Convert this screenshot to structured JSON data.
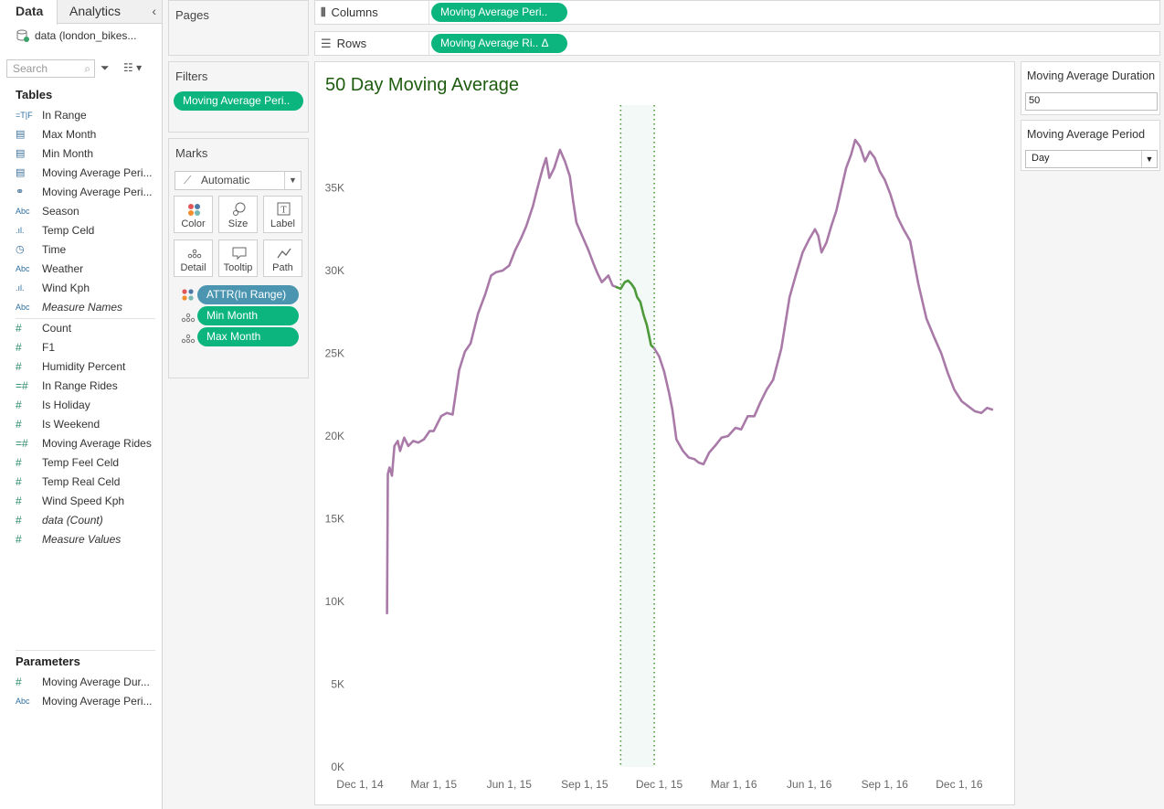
{
  "data_pane": {
    "tabs": [
      "Data",
      "Analytics"
    ],
    "datasource": "data (london_bikes...",
    "search_placeholder": "Search",
    "tables_title": "Tables",
    "dimensions": [
      {
        "type": "=T|F",
        "name": "In Range"
      },
      {
        "type": "cal",
        "name": "Max Month"
      },
      {
        "type": "cal",
        "name": "Min Month"
      },
      {
        "type": "cal",
        "name": "Moving Average Peri..."
      },
      {
        "type": "link",
        "name": "Moving Average Peri..."
      },
      {
        "type": "Abc",
        "name": "Season"
      },
      {
        "type": "bin",
        "name": "Temp Celd"
      },
      {
        "type": "time",
        "name": "Time"
      },
      {
        "type": "Abc",
        "name": "Weather"
      },
      {
        "type": "bin",
        "name": "Wind Kph"
      },
      {
        "type": "Abc",
        "name": "Measure Names",
        "italic": true
      }
    ],
    "measures": [
      {
        "type": "#",
        "name": "Count"
      },
      {
        "type": "#",
        "name": "F1"
      },
      {
        "type": "#",
        "name": "Humidity Percent"
      },
      {
        "type": "=#",
        "name": "In Range Rides"
      },
      {
        "type": "#",
        "name": "Is Holiday"
      },
      {
        "type": "#",
        "name": "Is Weekend"
      },
      {
        "type": "=#",
        "name": "Moving Average Rides"
      },
      {
        "type": "#",
        "name": "Temp Feel Celd"
      },
      {
        "type": "#",
        "name": "Temp Real Celd"
      },
      {
        "type": "#",
        "name": "Wind Speed Kph"
      },
      {
        "type": "#",
        "name": "data (Count)",
        "italic": true
      },
      {
        "type": "#",
        "name": "Measure Values",
        "italic": true
      }
    ],
    "parameters_title": "Parameters",
    "parameters": [
      {
        "type": "#",
        "name": "Moving Average Dur..."
      },
      {
        "type": "Abc",
        "name": "Moving Average Peri..."
      }
    ]
  },
  "pages": {
    "title": "Pages"
  },
  "filters": {
    "title": "Filters",
    "pill": "Moving Average Peri.."
  },
  "marks": {
    "title": "Marks",
    "type": "Automatic",
    "buttons": [
      "Color",
      "Size",
      "Label",
      "Detail",
      "Tooltip",
      "Path"
    ],
    "pills": [
      {
        "label": "ATTR(In Range)",
        "color": "blue"
      },
      {
        "label": "Min Month",
        "color": "green"
      },
      {
        "label": "Max Month",
        "color": "green"
      }
    ]
  },
  "columns": {
    "label": "Columns",
    "pill": "Moving Average Peri.."
  },
  "rows": {
    "label": "Rows",
    "pill": "Moving Average Ri.. Δ"
  },
  "params_panel": {
    "duration": {
      "title": "Moving Average Duration",
      "value": "50"
    },
    "period": {
      "title": "Moving Average Period",
      "value": "Day"
    }
  },
  "colors": {
    "pill_green": "#0db57e",
    "pill_blue": "#4b95b0",
    "line_purple": "#a97aa8",
    "line_green": "#4e9a3a",
    "title_green": "#1f5c10"
  },
  "chart_data": {
    "type": "line",
    "title": "50 Day Moving Average",
    "xlabel": "",
    "ylabel": "",
    "ylim": [
      0,
      40000
    ],
    "yticks": [
      0,
      5000,
      10000,
      15000,
      20000,
      25000,
      30000,
      35000
    ],
    "ytick_labels": [
      "0K",
      "5K",
      "10K",
      "15K",
      "20K",
      "25K",
      "30K",
      "35K"
    ],
    "xticks": [
      "2014-12-01",
      "2015-03-01",
      "2015-06-01",
      "2015-09-01",
      "2015-12-01",
      "2016-03-01",
      "2016-06-01",
      "2016-09-01",
      "2016-12-01"
    ],
    "xtick_labels": [
      "Dec 1, 14",
      "Mar 1, 15",
      "Jun 1, 15",
      "Sep 1, 15",
      "Dec 1, 15",
      "Mar 1, 16",
      "Jun 1, 16",
      "Sep 1, 16",
      "Dec 1, 16"
    ],
    "xlim": [
      "2014-11-21",
      "2017-01-18"
    ],
    "highlight_range": [
      "2015-10-15",
      "2015-11-25"
    ],
    "series": [
      {
        "name": "",
        "color": "#a97aa8",
        "points": [
          [
            "2015-01-03",
            9300
          ],
          [
            "2015-01-04",
            17700
          ],
          [
            "2015-01-06",
            18100
          ],
          [
            "2015-01-09",
            17600
          ],
          [
            "2015-01-12",
            19400
          ],
          [
            "2015-01-16",
            19700
          ],
          [
            "2015-01-19",
            19100
          ],
          [
            "2015-01-24",
            19900
          ],
          [
            "2015-01-29",
            19400
          ],
          [
            "2015-02-04",
            19700
          ],
          [
            "2015-02-10",
            19600
          ],
          [
            "2015-02-17",
            19800
          ],
          [
            "2015-02-24",
            20300
          ],
          [
            "2015-03-01",
            20300
          ],
          [
            "2015-03-10",
            21200
          ],
          [
            "2015-03-17",
            21400
          ],
          [
            "2015-03-24",
            21300
          ],
          [
            "2015-04-01",
            24000
          ],
          [
            "2015-04-08",
            25100
          ],
          [
            "2015-04-15",
            25600
          ],
          [
            "2015-04-24",
            27400
          ],
          [
            "2015-05-03",
            28600
          ],
          [
            "2015-05-10",
            29700
          ],
          [
            "2015-05-16",
            29900
          ],
          [
            "2015-05-24",
            30000
          ],
          [
            "2015-06-01",
            30300
          ],
          [
            "2015-06-08",
            31200
          ],
          [
            "2015-06-16",
            32000
          ],
          [
            "2015-06-22",
            32700
          ],
          [
            "2015-06-30",
            33900
          ],
          [
            "2015-07-05",
            34900
          ],
          [
            "2015-07-12",
            36200
          ],
          [
            "2015-07-16",
            36800
          ],
          [
            "2015-07-20",
            35600
          ],
          [
            "2015-07-26",
            36200
          ],
          [
            "2015-08-02",
            37300
          ],
          [
            "2015-08-08",
            36600
          ],
          [
            "2015-08-14",
            35700
          ],
          [
            "2015-08-18",
            34200
          ],
          [
            "2015-08-22",
            32900
          ],
          [
            "2015-08-29",
            32100
          ],
          [
            "2015-09-06",
            31200
          ],
          [
            "2015-09-12",
            30400
          ],
          [
            "2015-09-17",
            29800
          ],
          [
            "2015-09-22",
            29300
          ],
          [
            "2015-09-30",
            29700
          ],
          [
            "2015-10-05",
            29100
          ],
          [
            "2015-10-10",
            29000
          ]
        ]
      },
      {
        "name": "",
        "color": "#4e9a3a",
        "points": [
          [
            "2015-10-10",
            29000
          ],
          [
            "2015-10-15",
            28900
          ],
          [
            "2015-10-20",
            29300
          ],
          [
            "2015-10-24",
            29400
          ],
          [
            "2015-10-28",
            29200
          ],
          [
            "2015-11-01",
            28900
          ],
          [
            "2015-11-04",
            28400
          ],
          [
            "2015-11-08",
            28100
          ],
          [
            "2015-11-12",
            27300
          ],
          [
            "2015-11-16",
            26700
          ],
          [
            "2015-11-21",
            25500
          ],
          [
            "2015-11-25",
            25300
          ]
        ]
      },
      {
        "name": "",
        "color": "#a97aa8",
        "points": [
          [
            "2015-11-25",
            25300
          ],
          [
            "2015-12-01",
            24800
          ],
          [
            "2015-12-07",
            23900
          ],
          [
            "2015-12-13",
            22600
          ],
          [
            "2015-12-17",
            21600
          ],
          [
            "2015-12-22",
            19800
          ],
          [
            "2015-12-30",
            19100
          ],
          [
            "2016-01-06",
            18700
          ],
          [
            "2016-01-13",
            18600
          ],
          [
            "2016-01-18",
            18400
          ],
          [
            "2016-01-24",
            18300
          ],
          [
            "2016-01-31",
            19000
          ],
          [
            "2016-02-07",
            19400
          ],
          [
            "2016-02-15",
            19900
          ],
          [
            "2016-02-23",
            20000
          ],
          [
            "2016-03-03",
            20500
          ],
          [
            "2016-03-10",
            20400
          ],
          [
            "2016-03-18",
            21200
          ],
          [
            "2016-03-26",
            21200
          ],
          [
            "2016-04-02",
            22000
          ],
          [
            "2016-04-10",
            22800
          ],
          [
            "2016-04-18",
            23400
          ],
          [
            "2016-04-28",
            25300
          ],
          [
            "2016-05-08",
            28400
          ],
          [
            "2016-05-16",
            29800
          ],
          [
            "2016-05-24",
            31100
          ],
          [
            "2016-06-01",
            31900
          ],
          [
            "2016-06-08",
            32500
          ],
          [
            "2016-06-12",
            32100
          ],
          [
            "2016-06-16",
            31100
          ],
          [
            "2016-06-22",
            31700
          ],
          [
            "2016-06-28",
            32700
          ],
          [
            "2016-07-04",
            33600
          ],
          [
            "2016-07-10",
            34900
          ],
          [
            "2016-07-16",
            36200
          ],
          [
            "2016-07-22",
            37000
          ],
          [
            "2016-07-27",
            37900
          ],
          [
            "2016-08-02",
            37500
          ],
          [
            "2016-08-08",
            36600
          ],
          [
            "2016-08-14",
            37200
          ],
          [
            "2016-08-20",
            36800
          ],
          [
            "2016-08-26",
            36000
          ],
          [
            "2016-09-01",
            35500
          ],
          [
            "2016-09-08",
            34600
          ],
          [
            "2016-09-16",
            33300
          ],
          [
            "2016-09-24",
            32500
          ],
          [
            "2016-10-02",
            31800
          ],
          [
            "2016-10-12",
            29200
          ],
          [
            "2016-10-22",
            27100
          ],
          [
            "2016-11-01",
            25900
          ],
          [
            "2016-11-09",
            25000
          ],
          [
            "2016-11-17",
            23800
          ],
          [
            "2016-11-25",
            22800
          ],
          [
            "2016-12-04",
            22100
          ],
          [
            "2016-12-12",
            21800
          ],
          [
            "2016-12-20",
            21500
          ],
          [
            "2016-12-28",
            21400
          ],
          [
            "2017-01-04",
            21700
          ],
          [
            "2017-01-10",
            21600
          ]
        ]
      }
    ]
  }
}
